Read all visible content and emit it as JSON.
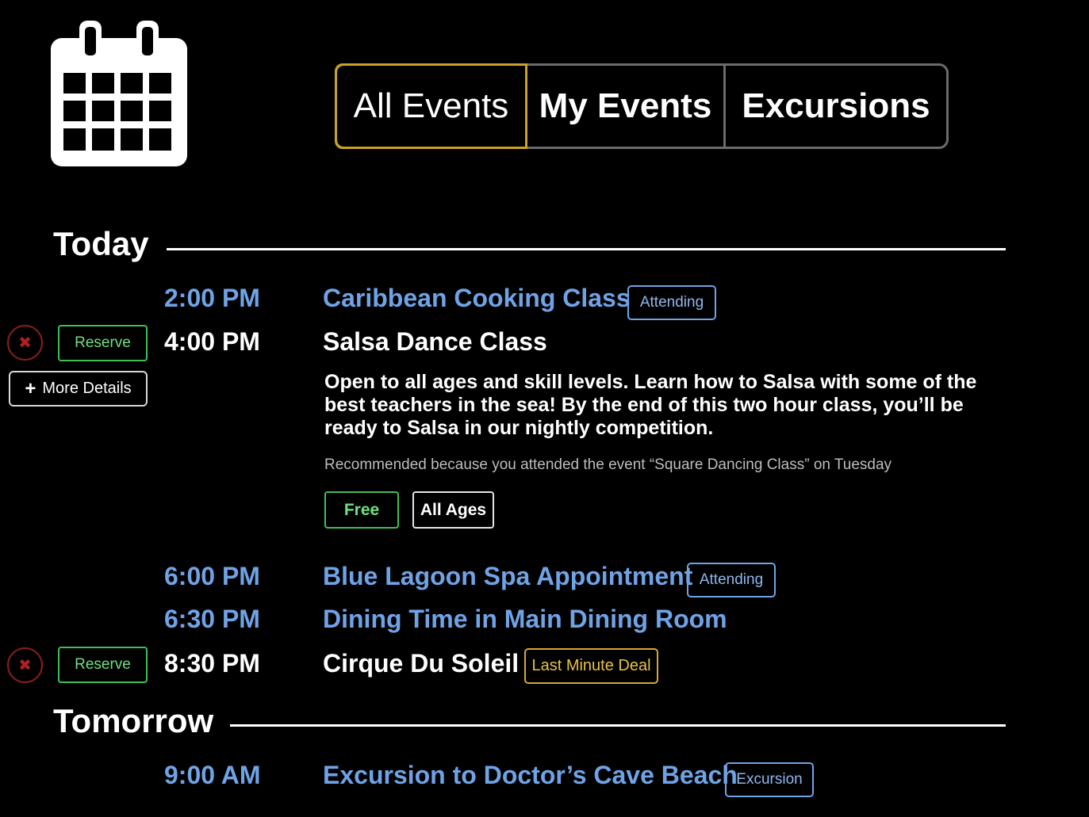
{
  "header": {
    "icon": "calendar-icon"
  },
  "tabs": [
    {
      "label": "All Events",
      "active": true
    },
    {
      "label": "My Events",
      "active": false
    },
    {
      "label": "Excursions",
      "active": false
    }
  ],
  "colors": {
    "accent_gold": "#c9a227",
    "link_blue": "#6fa3e6",
    "reserve_green": "#3fbf55",
    "remove_red": "#8b1d1d"
  },
  "today": {
    "heading": "Today",
    "events": [
      {
        "time": "2:00 PM",
        "title": "Caribbean Cooking Class",
        "badge": "Attending"
      },
      {
        "time": "4:00 PM",
        "title": "Salsa Dance Class",
        "reserve_label": "Reserve",
        "more_label": "More Details",
        "description": "Open to all ages and skill levels. Learn how to Salsa with some of the best teachers in the sea! By the end of this two hour class, you’ll be ready to Salsa in our nightly competition.",
        "recommendation": "Recommended because you attended the event “Square Dancing Class” on Tuesday",
        "tags": [
          "Free",
          "All Ages"
        ]
      },
      {
        "time": "6:00 PM",
        "title": "Blue Lagoon Spa Appointment",
        "badge": "Attending"
      },
      {
        "time": "6:30 PM",
        "title": "Dining Time in Main Dining Room"
      },
      {
        "time": "8:30 PM",
        "title": "Cirque Du Soleil",
        "badge": "Last Minute Deal",
        "reserve_label": "Reserve"
      }
    ]
  },
  "tomorrow": {
    "heading": "Tomorrow",
    "events": [
      {
        "time": "9:00 AM",
        "title": "Excursion to Doctor’s Cave Beach",
        "badge": "Excursion"
      }
    ]
  }
}
